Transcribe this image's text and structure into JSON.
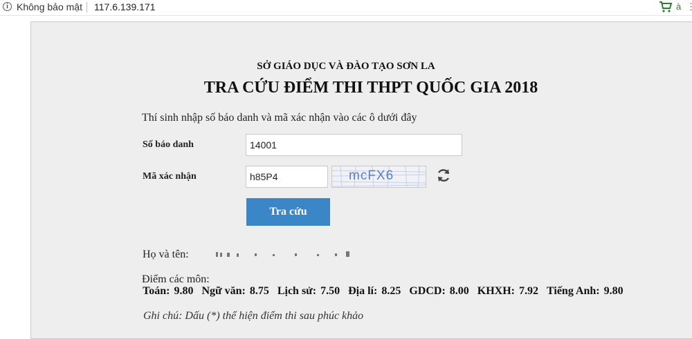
{
  "browser": {
    "security_label": "Không bảo mật",
    "url": "117.6.139.171",
    "info_icon_glyph": "i",
    "translate_glyph": "à",
    "more_glyph": "⋮",
    "icons": [
      "info-icon",
      "shopping-cart-icon",
      "translate-icon",
      "more-icon"
    ]
  },
  "page": {
    "org_name": "SỞ GIÁO DỤC VÀ ĐÀO TẠO SƠN LA",
    "title": "TRA CỨU ĐIỂM THI THPT QUỐC GIA 2018",
    "intro": "Thí sinh nhập số báo danh và mã xác nhận vào các ô dưới đây"
  },
  "form": {
    "sbd_label": "Số báo danh",
    "sbd_value": "14001",
    "mxn_label": "Mã xác nhận",
    "mxn_value": "h85P4",
    "captcha_text": "mcFX6",
    "submit_label": "Tra cứu"
  },
  "result": {
    "name_label": "Họ và tên:",
    "scores_label": "Điểm các môn:",
    "scores": [
      {
        "subject": "Toán:",
        "score": "9.80"
      },
      {
        "subject": "Ngữ văn:",
        "score": "8.75"
      },
      {
        "subject": "Lịch sử:",
        "score": "7.50"
      },
      {
        "subject": "Địa lí:",
        "score": "8.25"
      },
      {
        "subject": "GDCD:",
        "score": "8.00"
      },
      {
        "subject": "KHXH:",
        "score": "7.92"
      },
      {
        "subject": "Tiếng Anh:",
        "score": "9.80"
      }
    ],
    "note": "Ghi chú: Dấu (*) thể hiện điểm thi sau phúc khảo"
  },
  "colors": {
    "button": "#3b86c6",
    "panel": "#eeeeee",
    "captcha_text": "#5b7fc4",
    "toolbar_green": "#2e7d32"
  }
}
